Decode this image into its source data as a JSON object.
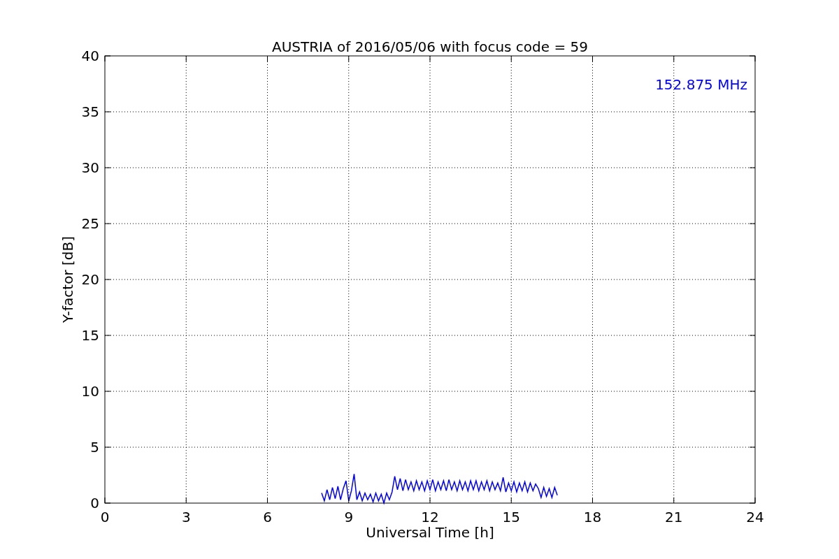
{
  "figure": {
    "chart_data": {
      "type": "line",
      "title": "AUSTRIA of 2016/05/06 with focus code = 59",
      "xlabel": "Universal Time [h]",
      "ylabel": "Y-factor [dB]",
      "x": [
        8.0,
        8.1,
        8.2,
        8.3,
        8.4,
        8.5,
        8.6,
        8.7,
        8.8,
        8.9,
        9.0,
        9.1,
        9.2,
        9.3,
        9.4,
        9.5,
        9.6,
        9.7,
        9.8,
        9.9,
        10.0,
        10.1,
        10.2,
        10.3,
        10.4,
        10.5,
        10.6,
        10.7,
        10.8,
        10.9,
        11.0,
        11.1,
        11.2,
        11.3,
        11.4,
        11.5,
        11.6,
        11.7,
        11.8,
        11.9,
        12.0,
        12.1,
        12.2,
        12.3,
        12.4,
        12.5,
        12.6,
        12.7,
        12.8,
        12.9,
        13.0,
        13.1,
        13.2,
        13.3,
        13.4,
        13.5,
        13.6,
        13.7,
        13.8,
        13.9,
        14.0,
        14.1,
        14.2,
        14.3,
        14.4,
        14.5,
        14.6,
        14.7,
        14.8,
        14.9,
        15.0,
        15.1,
        15.2,
        15.3,
        15.4,
        15.5,
        15.6,
        15.7,
        15.8,
        15.9,
        16.0,
        16.1,
        16.2,
        16.3,
        16.4,
        16.5,
        16.6,
        16.7
      ],
      "series": [
        {
          "name": "152.875 MHz",
          "color": "#0000ff",
          "values": [
            0.9,
            0.2,
            1.2,
            0.3,
            1.4,
            0.4,
            1.5,
            0.3,
            1.3,
            2.0,
            0.2,
            1.1,
            2.6,
            0.3,
            1.0,
            0.2,
            0.9,
            0.3,
            0.8,
            0.1,
            0.9,
            0.2,
            0.8,
            0.0,
            0.9,
            0.3,
            1.0,
            2.4,
            1.2,
            2.2,
            1.1,
            2.1,
            1.2,
            1.9,
            1.1,
            2.0,
            1.2,
            1.9,
            1.1,
            2.0,
            1.2,
            2.1,
            1.1,
            1.9,
            1.2,
            2.0,
            1.1,
            2.1,
            1.2,
            1.9,
            1.1,
            2.0,
            1.2,
            1.9,
            1.1,
            2.0,
            1.2,
            2.0,
            1.1,
            1.9,
            1.2,
            2.0,
            1.1,
            1.9,
            1.2,
            1.8,
            1.1,
            2.3,
            1.0,
            1.8,
            1.1,
            1.9,
            1.0,
            1.8,
            1.1,
            1.9,
            1.0,
            1.8,
            1.1,
            1.7,
            1.3,
            0.5,
            1.4,
            0.6,
            1.3,
            0.5,
            1.4,
            0.7
          ]
        }
      ],
      "xlim": [
        0,
        24
      ],
      "ylim": [
        0,
        40
      ],
      "xticks": [
        0,
        3,
        6,
        9,
        12,
        15,
        18,
        21,
        24
      ],
      "yticks": [
        0,
        5,
        10,
        15,
        20,
        25,
        30,
        35,
        40
      ],
      "grid": true
    }
  }
}
